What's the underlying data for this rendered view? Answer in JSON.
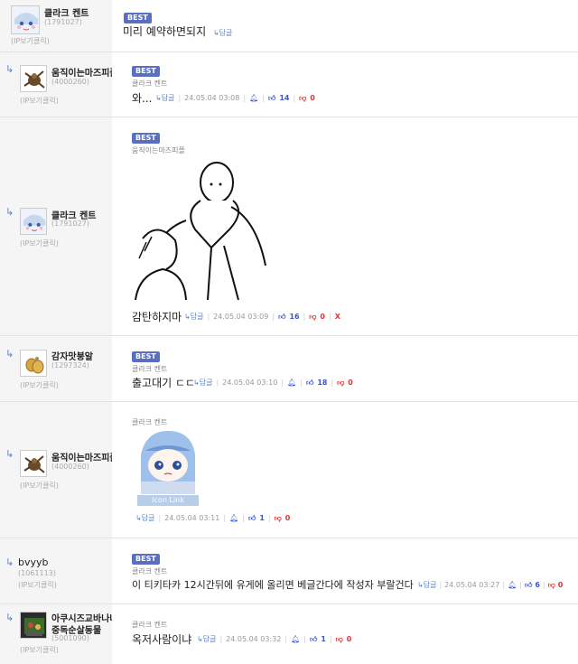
{
  "comments": [
    {
      "nick": "클라크 켄트",
      "uid": "(1791027)",
      "ip": "(IP보기클릭)",
      "best": "BEST",
      "text": "미리 예약하면되지",
      "reply": "↳답글"
    },
    {
      "nick": "움직이는마즈피플",
      "uid": "(4000260)",
      "ip": "(IP보기클릭)",
      "best": "BEST",
      "mention": "클라크 켄트",
      "text": "와...",
      "reply": "↳답글",
      "date": "24.05.04 03:08",
      "up": "14",
      "down": "0"
    },
    {
      "nick": "클라크 켄트",
      "uid": "(1791027)",
      "ip": "(IP보기클릭)",
      "best": "BEST",
      "mention": "움직이는마즈피플",
      "text": "감탄하지마",
      "reply": "↳답글",
      "date": "24.05.04 03:09",
      "up": "16",
      "down": "0",
      "x": "X"
    },
    {
      "nick": "감자맛붕알",
      "uid": "(1297324)",
      "ip": "(IP보기클릭)",
      "best": "BEST",
      "mention": "클라크 켄트",
      "text": "출고대기 ㄷㄷ",
      "reply": "↳답글",
      "date": "24.05.04 03:10",
      "up": "18",
      "down": "0"
    },
    {
      "nick": "움직이는마즈피플",
      "uid": "(4000260)",
      "ip": "(IP보기클릭)",
      "mention": "클라크 켄트",
      "icon_link": "Icon Link",
      "reply": "↳답글",
      "date": "24.05.04 03:11",
      "up": "1",
      "down": "0"
    },
    {
      "nick": "bvyyb",
      "uid": "(1061113)",
      "ip": "(IP보기클릭)",
      "best": "BEST",
      "mention": "클라크 켄트",
      "text": "이 티키타카 12시간뒤에 유게에 올리면 베글간다에 작성자 부랄건다",
      "reply": "↳답글",
      "date": "24.05.04 03:27",
      "up": "6",
      "down": "0"
    },
    {
      "nick_line1": "아쿠시즈교바나나",
      "nick_line2": "중독순살동물",
      "uid": "(5001090)",
      "ip": "(IP보기클릭)",
      "mention": "클라크 켄트",
      "text": "옥저사람이냐",
      "reply": "↳답글",
      "date": "24.05.04 03:32",
      "up": "1",
      "down": "0"
    }
  ],
  "colors": {
    "best": "#5b6fc2",
    "up": "#3a57c4",
    "down": "#dd3333",
    "reply": "#5a7fc9"
  }
}
